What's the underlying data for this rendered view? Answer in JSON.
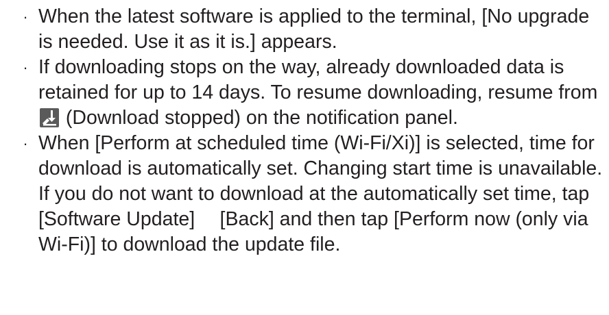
{
  "bullet_glyph": "·",
  "notes": [
    {
      "text": "When the latest software is applied to the terminal, [No upgrade is needed. Use it as it is.] appears."
    },
    {
      "text_before_icon": "If downloading stops on the way, already downloaded data is retained for up to 14 days. To resume downloading, resume from ",
      "icon": "download-stopped-icon",
      "text_after_icon": " (Download stopped) on the notification panel."
    },
    {
      "text": "When [Perform at scheduled time (Wi-Fi/Xi)] is selected, time for download is automatically set. Changing start time is unavailable. If you do not want to download at the automatically set time, tap [Software Update]  [Back] and then tap [Perform now (only via Wi-Fi)] to download the update file."
    }
  ],
  "colors": {
    "text": "#231f20",
    "icon_background": "#5a5a5a",
    "icon_foreground": "#ffffff"
  }
}
